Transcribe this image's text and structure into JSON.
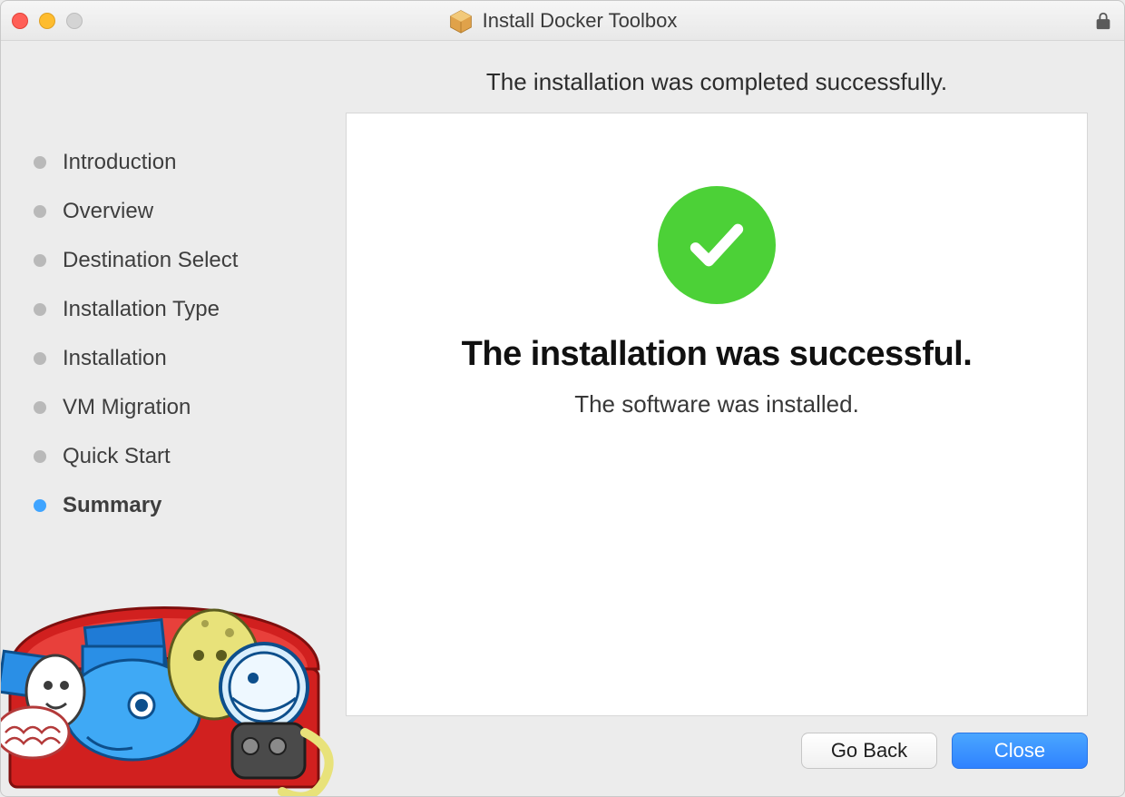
{
  "window": {
    "title": "Install Docker Toolbox"
  },
  "header": {
    "subtitle": "The installation was completed successfully."
  },
  "sidebar": {
    "steps": [
      {
        "label": "Introduction",
        "active": false
      },
      {
        "label": "Overview",
        "active": false
      },
      {
        "label": "Destination Select",
        "active": false
      },
      {
        "label": "Installation Type",
        "active": false
      },
      {
        "label": "Installation",
        "active": false
      },
      {
        "label": "VM Migration",
        "active": false
      },
      {
        "label": "Quick Start",
        "active": false
      },
      {
        "label": "Summary",
        "active": true
      }
    ]
  },
  "panel": {
    "heading": "The installation was successful.",
    "message": "The software was installed."
  },
  "footer": {
    "back": "Go Back",
    "close": "Close"
  },
  "colors": {
    "success_green": "#4cd137",
    "accent_blue": "#3fa4ff",
    "primary_button_top": "#4aa6ff",
    "primary_button_bottom": "#2f82ff"
  },
  "icons": {
    "package": "package-icon",
    "lock": "lock-icon",
    "checkmark": "checkmark-icon",
    "toolbox_art": "docker-toolbox-art"
  }
}
